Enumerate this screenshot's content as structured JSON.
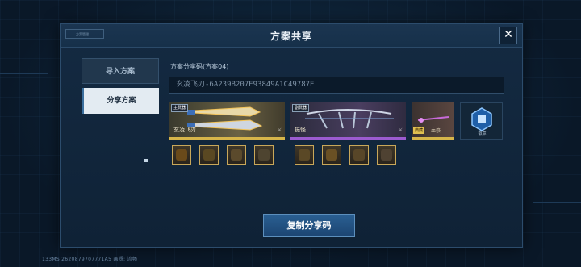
{
  "dialog": {
    "title": "方案共享",
    "close_label": "✕",
    "brand_tag": "方案管理"
  },
  "tabs": [
    {
      "label": "导入方案",
      "active": false
    },
    {
      "label": "分享方案",
      "active": true
    }
  ],
  "share": {
    "label": "方案分享码(方案04)",
    "code": "玄凌飞刃-6A239B207E93849A1C49787E"
  },
  "loadout": {
    "main_weapon": {
      "tag": "主武器",
      "name": "玄凌飞刃"
    },
    "secondary_weapon": {
      "tag": "副武器",
      "name": "振怪"
    },
    "extra_item": {
      "rarity": "典藏",
      "name": "血祭"
    },
    "emblem": {
      "name": "徽章"
    },
    "left_runes": [
      "rune-1",
      "rune-2",
      "rune-3",
      "rune-4"
    ],
    "right_runes": [
      "rune-5",
      "rune-6",
      "rune-7",
      "rune-8"
    ]
  },
  "copy_button": "复制分享码",
  "footer": "133MS  2620879707771A5    画质: 流畅",
  "colors": {
    "gold": "#d6b54a",
    "purple": "#9c5bd0",
    "accent_blue": "#2a5f92"
  }
}
